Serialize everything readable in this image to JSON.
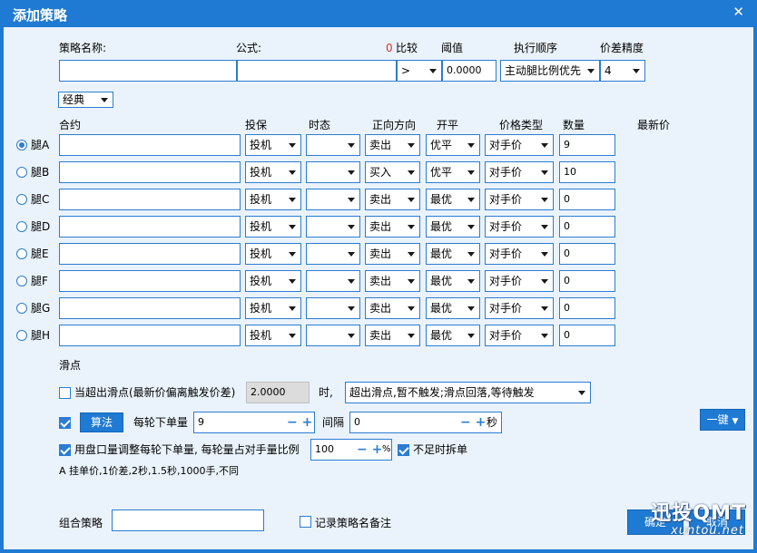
{
  "window": {
    "title": "添加策略",
    "close_icon": "✕"
  },
  "header": {
    "name_label": "策略名称:",
    "formula_label": "公式:",
    "count": "0",
    "compare_label": "比较",
    "threshold_label": "阈值",
    "order_label": "执行顺序",
    "precision_label": "价差精度",
    "name_value": "",
    "formula_value": "",
    "compare_value": ">",
    "threshold_value": "0.0000",
    "order_value": "主动腿比例优先",
    "precision_value": "4"
  },
  "mode_select": "经典",
  "columns": {
    "contract": "合约",
    "hedge": "投保",
    "state": "时态",
    "direction": "正向方向",
    "open_close": "开平",
    "price_type": "价格类型",
    "quantity": "数量",
    "last_price": "最新价"
  },
  "legs": [
    {
      "label": "腿A",
      "selected": true,
      "contract": "",
      "hedge": "投机",
      "state": "",
      "direction": "卖出",
      "open_close": "优平",
      "price_type": "对手价",
      "quantity": "9"
    },
    {
      "label": "腿B",
      "selected": false,
      "contract": "",
      "hedge": "投机",
      "state": "",
      "direction": "买入",
      "open_close": "优平",
      "price_type": "对手价",
      "quantity": "10"
    },
    {
      "label": "腿C",
      "selected": false,
      "contract": "",
      "hedge": "投机",
      "state": "",
      "direction": "卖出",
      "open_close": "最优",
      "price_type": "对手价",
      "quantity": "0"
    },
    {
      "label": "腿D",
      "selected": false,
      "contract": "",
      "hedge": "投机",
      "state": "",
      "direction": "卖出",
      "open_close": "最优",
      "price_type": "对手价",
      "quantity": "0"
    },
    {
      "label": "腿E",
      "selected": false,
      "contract": "",
      "hedge": "投机",
      "state": "",
      "direction": "卖出",
      "open_close": "最优",
      "price_type": "对手价",
      "quantity": "0"
    },
    {
      "label": "腿F",
      "selected": false,
      "contract": "",
      "hedge": "投机",
      "state": "",
      "direction": "卖出",
      "open_close": "最优",
      "price_type": "对手价",
      "quantity": "0"
    },
    {
      "label": "腿G",
      "selected": false,
      "contract": "",
      "hedge": "投机",
      "state": "",
      "direction": "卖出",
      "open_close": "最优",
      "price_type": "对手价",
      "quantity": "0"
    },
    {
      "label": "腿H",
      "selected": false,
      "contract": "",
      "hedge": "投机",
      "state": "",
      "direction": "卖出",
      "open_close": "最优",
      "price_type": "对手价",
      "quantity": "0"
    }
  ],
  "slippage": {
    "section_label": "滑点",
    "over_label": "当超出滑点(最新价偏离触发价差)",
    "over_checked": false,
    "over_value": "2.0000",
    "time_label": "时,",
    "over_action": "超出滑点,暂不触发;滑点回落,等待触发"
  },
  "algo": {
    "checked": true,
    "button_label": "算法",
    "per_round_label": "每轮下单量",
    "per_round_value": "9",
    "interval_label": "间隔",
    "interval_value": "0",
    "interval_unit": "秒",
    "one_click_label": "一键"
  },
  "adjust": {
    "checked": true,
    "label": "用盘口量调整每轮下单量, 每轮量占对手量比例",
    "ratio_value": "100",
    "ratio_unit": "%",
    "split_checked": true,
    "split_label": "不足时拆单"
  },
  "summary_text": "A 挂单价,1价差,2秒,1.5秒,1000手,不同",
  "footer": {
    "combo_label": "组合策略",
    "combo_value": "",
    "note_checked": false,
    "note_label": "记录策略名备注",
    "ok_label": "确定",
    "cancel_label": "取消"
  },
  "watermark": {
    "brand": "迅投QMT",
    "url": "xuntou.net"
  },
  "colors": {
    "title_bar": "#1f7ad4",
    "panel_bg": "#eaf3fb",
    "border": "#2b7cd3",
    "count_red": "#e0302a"
  }
}
